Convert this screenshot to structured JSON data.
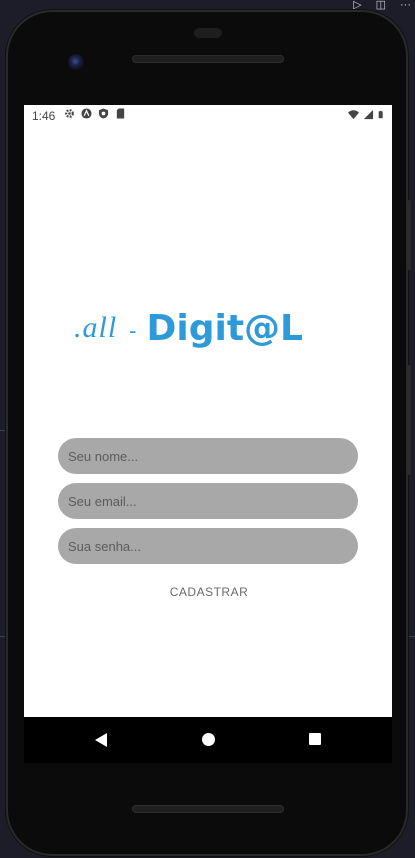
{
  "status_bar": {
    "time": "1:46"
  },
  "logo": {
    "all": ".all",
    "dash": "-",
    "digital": "Digit@L",
    "color": "#2e9ad8"
  },
  "form": {
    "name_placeholder": "Seu nome...",
    "email_placeholder": "Seu email...",
    "password_placeholder": "Sua senha...",
    "submit_label": "CADASTRAR",
    "field_color": "#a8a8a8"
  },
  "icons": {
    "status_left": [
      "settings-icon",
      "app-a-icon",
      "shield-icon",
      "sd-card-icon"
    ],
    "status_right": [
      "wifi-icon",
      "signal-icon",
      "battery-icon"
    ],
    "nav": [
      "back-icon",
      "home-icon",
      "recents-icon"
    ]
  }
}
